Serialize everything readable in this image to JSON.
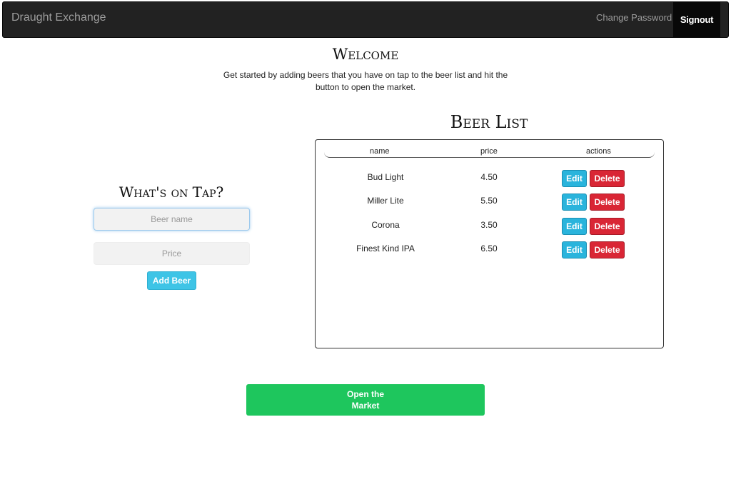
{
  "navbar": {
    "brand": "Draught Exchange",
    "change_password": "Change Password",
    "signout": "Signout"
  },
  "welcome": {
    "title": "Welcome",
    "text": "Get started by adding beers that you have on tap to the beer list and hit the button to open the market."
  },
  "tap_form": {
    "title": "What's on Tap?",
    "name_placeholder": "Beer name",
    "price_placeholder": "Price",
    "add_label": "Add Beer"
  },
  "beer_list": {
    "title": "Beer List",
    "columns": [
      "name",
      "price",
      "actions"
    ],
    "rows": [
      {
        "name": "Bud Light",
        "price": "4.50"
      },
      {
        "name": "Miller Lite",
        "price": "5.50"
      },
      {
        "name": "Corona",
        "price": "3.50"
      },
      {
        "name": "Finest Kind IPA",
        "price": "6.50"
      }
    ],
    "edit_label": "Edit",
    "delete_label": "Delete"
  },
  "market_button": "Open the Market",
  "colors": {
    "navbar": "#222222",
    "add_button": "#3ec4e6",
    "edit_button": "#2ab4dc",
    "delete_button": "#d92635",
    "market_button": "#1ec65d"
  }
}
